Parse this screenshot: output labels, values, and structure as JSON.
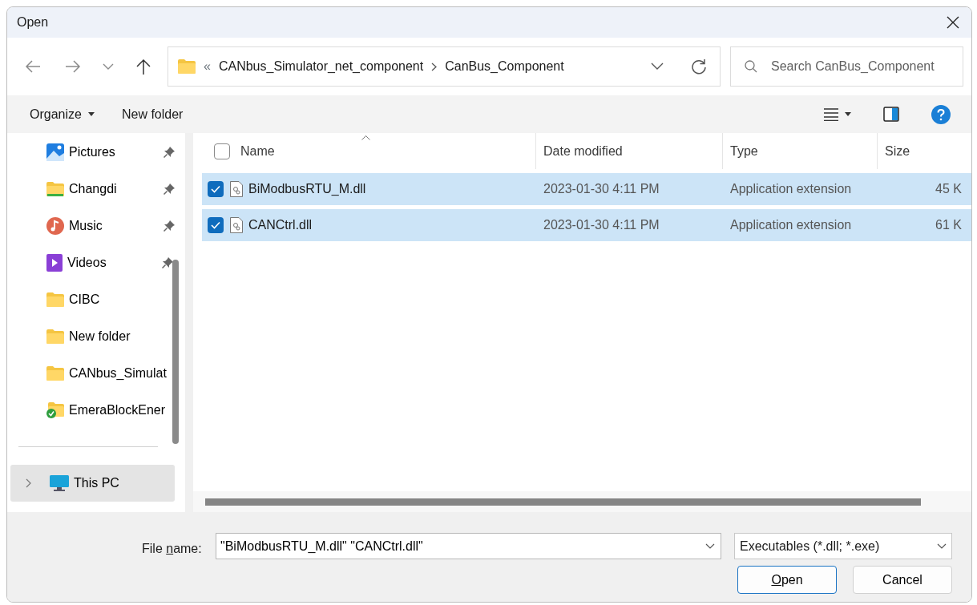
{
  "window": {
    "title": "Open"
  },
  "navigation": {
    "path": [
      "CANbus_Simulator_net_component",
      "CanBus_Component"
    ],
    "overflow": "«",
    "search": {
      "placeholder": "Search CanBus_Component"
    }
  },
  "command_bar": {
    "buttons": [
      "Organize",
      "New folder"
    ]
  },
  "sidebar": {
    "items": [
      {
        "label": "Pictures",
        "kind": "pictures",
        "pinned": true,
        "selected": false
      },
      {
        "label": "Changdi",
        "kind": "folder-green",
        "pinned": true,
        "selected": false
      },
      {
        "label": "Music",
        "kind": "music",
        "pinned": true,
        "selected": false
      },
      {
        "label": "Videos",
        "kind": "videos",
        "pinned": true,
        "selected": false
      },
      {
        "label": "CIBC",
        "kind": "folder",
        "pinned": false,
        "selected": false
      },
      {
        "label": "New folder",
        "kind": "folder",
        "pinned": false,
        "selected": false
      },
      {
        "label": "CANbus_Simulat",
        "kind": "folder",
        "pinned": false,
        "selected": false
      },
      {
        "label": "EmeraBlockEner",
        "kind": "folder-synced",
        "pinned": false,
        "selected": false
      }
    ],
    "bottom_items": [
      {
        "label": "This PC",
        "kind": "pc",
        "pinned": false,
        "selected": true,
        "expanded": false
      }
    ]
  },
  "table": {
    "select_all": {
      "checked": false
    },
    "columns": [
      {
        "label": "Name",
        "sorted": true
      },
      {
        "label": "Date modified",
        "sorted": false
      },
      {
        "label": "Type",
        "sorted": false
      },
      {
        "label": "Size",
        "sorted": false
      }
    ],
    "rows": [
      {
        "name": "BiModbusRTU_M.dll",
        "date": "2023-01-30 4:11 PM",
        "type": "Application extension",
        "size": "45 K",
        "checked": true,
        "selected": true
      },
      {
        "name": "CANCtrl.dll",
        "date": "2023-01-30 4:11 PM",
        "type": "Application extension",
        "size": "61 K",
        "checked": true,
        "selected": true
      }
    ]
  },
  "footer": {
    "file_name_label": {
      "before": "File ",
      "key": "n",
      "after": "ame:"
    },
    "file_name": "\"BiModbusRTU_M.dll\" \"CANCtrl.dll\"",
    "file_type": "Executables (*.dll; *.exe)",
    "buttons": [
      {
        "key": "O",
        "after": "pen",
        "kind": "primary"
      },
      {
        "after": "Cancel",
        "kind": "secondary"
      }
    ]
  }
}
